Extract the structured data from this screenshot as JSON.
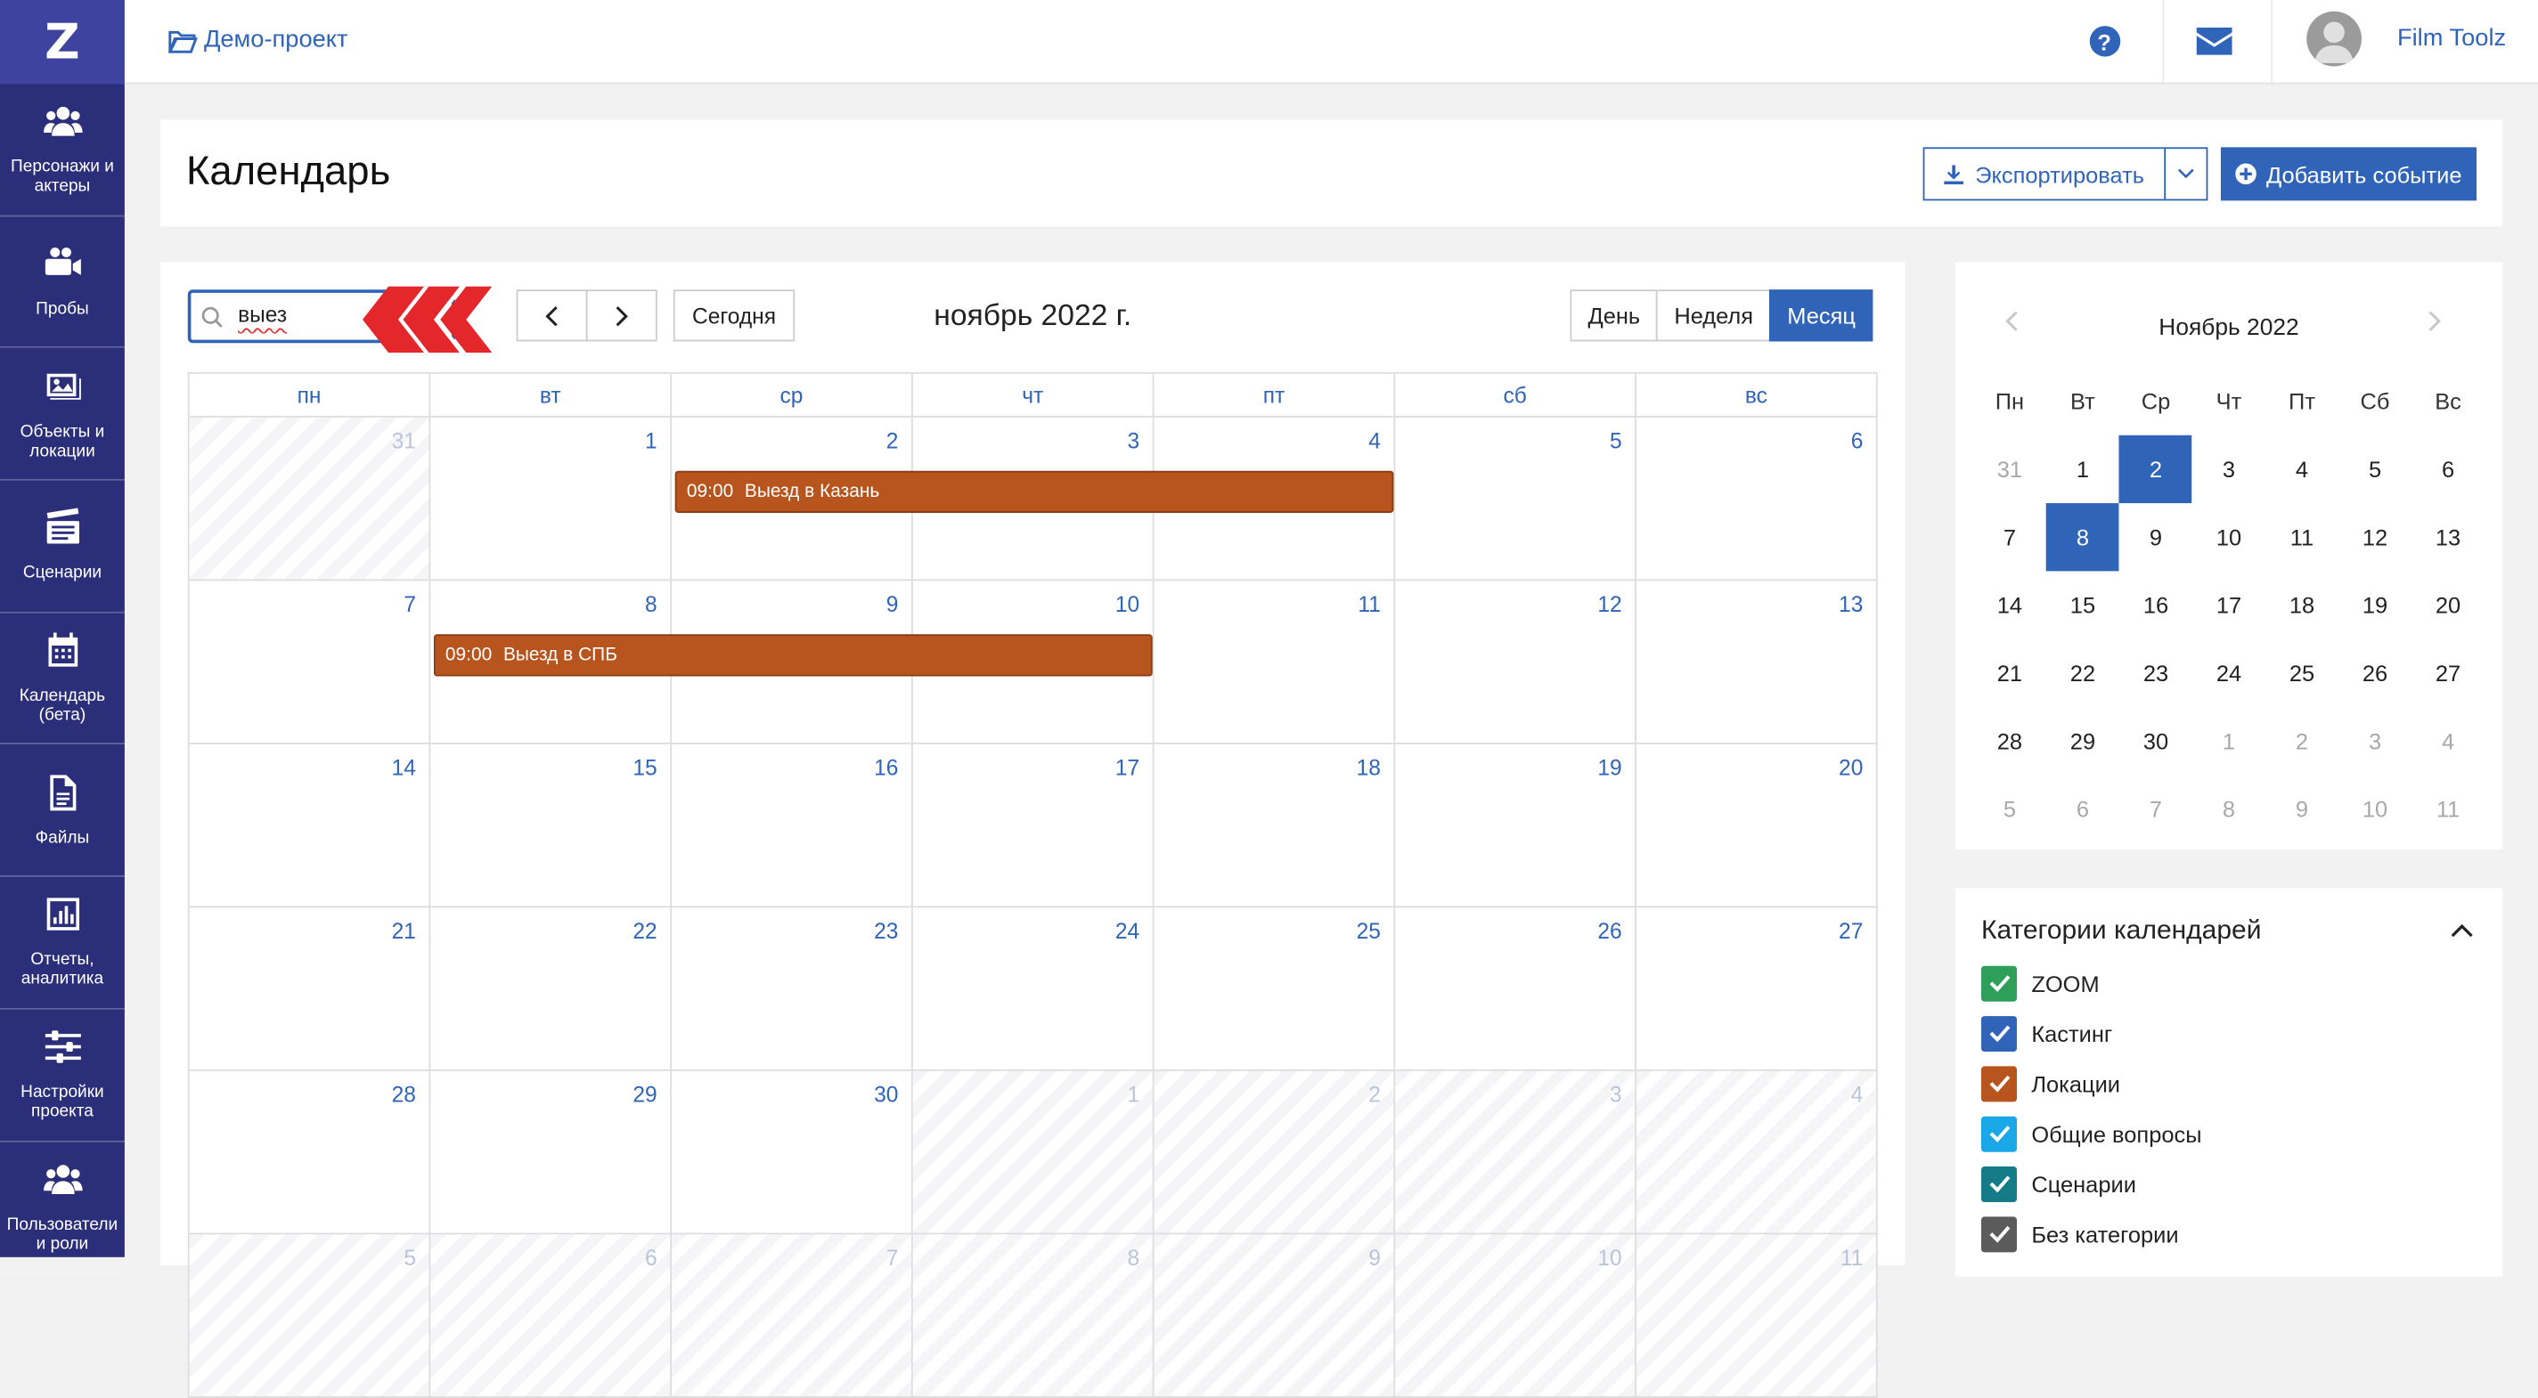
{
  "colors": {
    "primary": "#2f64b8",
    "sidebar": "#2b2e78",
    "event": "#b8541e"
  },
  "sidebar": {
    "logo": "Z",
    "items": [
      {
        "label": "Персонажи и актеры",
        "icon": "users-icon"
      },
      {
        "label": "Пробы",
        "icon": "video-camera-icon"
      },
      {
        "label": "Объекты и локации",
        "icon": "image-icon"
      },
      {
        "label": "Сценарии",
        "icon": "clapperboard-icon"
      },
      {
        "label": "Календарь (бета)",
        "icon": "calendar-icon"
      },
      {
        "label": "Файлы",
        "icon": "file-icon"
      },
      {
        "label": "Отчеты, аналитика",
        "icon": "chart-icon"
      },
      {
        "label": "Настройки проекта",
        "icon": "sliders-icon"
      },
      {
        "label": "Пользователи и роли",
        "icon": "users-icon"
      }
    ]
  },
  "topbar": {
    "project": "Демо-проект",
    "help": "?",
    "user": "Film Toolz"
  },
  "header": {
    "title": "Календарь",
    "export_label": "Экспортировать",
    "add_label": "Добавить событие"
  },
  "calendar": {
    "search": "выез",
    "today_label": "Сегодня",
    "month_title": "ноябрь 2022 г.",
    "views": [
      {
        "label": "День",
        "active": false
      },
      {
        "label": "Неделя",
        "active": false
      },
      {
        "label": "Месяц",
        "active": true
      }
    ],
    "dow": [
      "пн",
      "вт",
      "ср",
      "чт",
      "пт",
      "сб",
      "вс"
    ],
    "weeks": [
      [
        {
          "d": "31",
          "o": true
        },
        {
          "d": "1"
        },
        {
          "d": "2"
        },
        {
          "d": "3"
        },
        {
          "d": "4"
        },
        {
          "d": "5"
        },
        {
          "d": "6"
        }
      ],
      [
        {
          "d": "7"
        },
        {
          "d": "8"
        },
        {
          "d": "9"
        },
        {
          "d": "10"
        },
        {
          "d": "11"
        },
        {
          "d": "12"
        },
        {
          "d": "13"
        }
      ],
      [
        {
          "d": "14"
        },
        {
          "d": "15"
        },
        {
          "d": "16"
        },
        {
          "d": "17"
        },
        {
          "d": "18"
        },
        {
          "d": "19"
        },
        {
          "d": "20"
        }
      ],
      [
        {
          "d": "21"
        },
        {
          "d": "22"
        },
        {
          "d": "23"
        },
        {
          "d": "24"
        },
        {
          "d": "25"
        },
        {
          "d": "26"
        },
        {
          "d": "27"
        }
      ],
      [
        {
          "d": "28"
        },
        {
          "d": "29"
        },
        {
          "d": "30"
        },
        {
          "d": "1",
          "o": true
        },
        {
          "d": "2",
          "o": true
        },
        {
          "d": "3",
          "o": true
        },
        {
          "d": "4",
          "o": true
        }
      ],
      [
        {
          "d": "5",
          "o": true
        },
        {
          "d": "6",
          "o": true
        },
        {
          "d": "7",
          "o": true
        },
        {
          "d": "8",
          "o": true
        },
        {
          "d": "9",
          "o": true
        },
        {
          "d": "10",
          "o": true
        },
        {
          "d": "11",
          "o": true
        }
      ]
    ],
    "events": [
      {
        "week": 0,
        "start": 2,
        "span": 3,
        "time": "09:00",
        "title": "Выезд в Казань"
      },
      {
        "week": 1,
        "start": 1,
        "span": 3,
        "time": "09:00",
        "title": "Выезд в СПБ"
      }
    ]
  },
  "mini": {
    "title": "Ноябрь 2022",
    "dow": [
      "Пн",
      "Вт",
      "Ср",
      "Чт",
      "Пт",
      "Сб",
      "Вс"
    ],
    "weeks": [
      [
        {
          "d": "31",
          "m": true
        },
        {
          "d": "1"
        },
        {
          "d": "2",
          "s": true
        },
        {
          "d": "3"
        },
        {
          "d": "4"
        },
        {
          "d": "5"
        },
        {
          "d": "6"
        }
      ],
      [
        {
          "d": "7"
        },
        {
          "d": "8",
          "s": true
        },
        {
          "d": "9"
        },
        {
          "d": "10"
        },
        {
          "d": "11"
        },
        {
          "d": "12"
        },
        {
          "d": "13"
        }
      ],
      [
        {
          "d": "14"
        },
        {
          "d": "15"
        },
        {
          "d": "16"
        },
        {
          "d": "17"
        },
        {
          "d": "18"
        },
        {
          "d": "19"
        },
        {
          "d": "20"
        }
      ],
      [
        {
          "d": "21"
        },
        {
          "d": "22"
        },
        {
          "d": "23"
        },
        {
          "d": "24"
        },
        {
          "d": "25"
        },
        {
          "d": "26"
        },
        {
          "d": "27"
        }
      ],
      [
        {
          "d": "28"
        },
        {
          "d": "29"
        },
        {
          "d": "30"
        },
        {
          "d": "1",
          "m": true
        },
        {
          "d": "2",
          "m": true
        },
        {
          "d": "3",
          "m": true
        },
        {
          "d": "4",
          "m": true
        }
      ],
      [
        {
          "d": "5",
          "m": true
        },
        {
          "d": "6",
          "m": true
        },
        {
          "d": "7",
          "m": true
        },
        {
          "d": "8",
          "m": true
        },
        {
          "d": "9",
          "m": true
        },
        {
          "d": "10",
          "m": true
        },
        {
          "d": "11",
          "m": true
        }
      ]
    ]
  },
  "categories": {
    "title": "Категории календарей",
    "items": [
      {
        "label": "ZOOM",
        "color": "#2e9e5b"
      },
      {
        "label": "Кастинг",
        "color": "#2f64b8"
      },
      {
        "label": "Локации",
        "color": "#b8541e"
      },
      {
        "label": "Общие вопросы",
        "color": "#1aa7e8"
      },
      {
        "label": "Сценарии",
        "color": "#157b87"
      },
      {
        "label": "Без категории",
        "color": "#5b5b5b"
      }
    ]
  }
}
